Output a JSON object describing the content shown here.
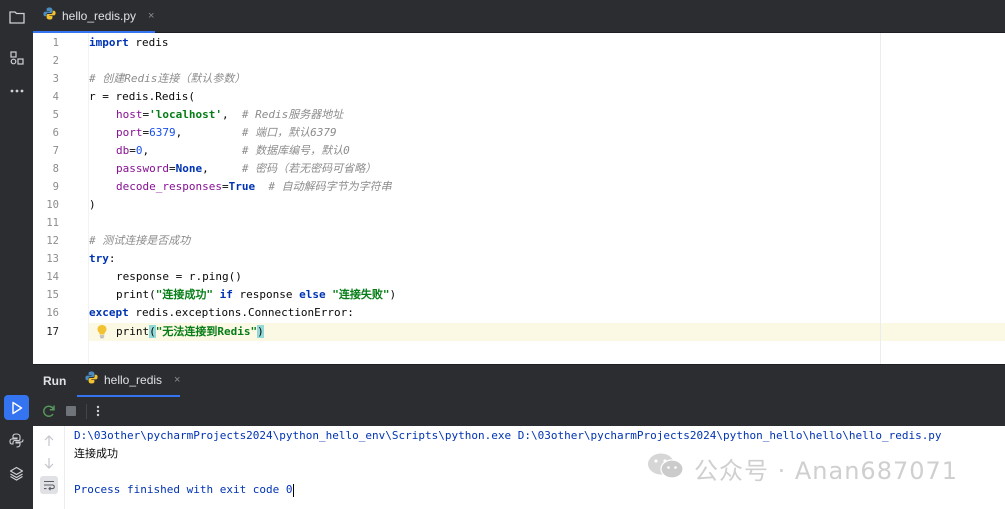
{
  "editor_tab": {
    "filename": "hello_redis.py",
    "close": "×"
  },
  "code_lines": [
    {
      "n": "1"
    },
    {
      "n": "2"
    },
    {
      "n": "3"
    },
    {
      "n": "4"
    },
    {
      "n": "5"
    },
    {
      "n": "6"
    },
    {
      "n": "7"
    },
    {
      "n": "8"
    },
    {
      "n": "9"
    },
    {
      "n": "10"
    },
    {
      "n": "11"
    },
    {
      "n": "12"
    },
    {
      "n": "13"
    },
    {
      "n": "14"
    },
    {
      "n": "15"
    },
    {
      "n": "16"
    },
    {
      "n": "17"
    }
  ],
  "code": {
    "l1_kw": "import",
    "l1_rest": " redis",
    "l3_comment": "# 创建Redis连接（默认参数）",
    "l4_a": "r = redis.Redis(",
    "l5_param": "host",
    "l5_eq": "=",
    "l5_str": "'localhost'",
    "l5_comma": ",  ",
    "l5_cmt": "# Redis服务器地址",
    "l6_param": "port",
    "l6_eq": "=",
    "l6_num": "6379",
    "l6_comma": ",         ",
    "l6_cmt": "# 端口，默认6379",
    "l7_param": "db",
    "l7_eq": "=",
    "l7_num": "0",
    "l7_comma": ",              ",
    "l7_cmt": "# 数据库编号，默认0",
    "l8_param": "password",
    "l8_eq": "=",
    "l8_kw": "None",
    "l8_comma": ",     ",
    "l8_cmt": "# 密码（若无密码可省略）",
    "l9_param": "decode_responses",
    "l9_eq": "=",
    "l9_kw": "True",
    "l9_sp": "  ",
    "l9_cmt": "# 自动解码字节为字符串",
    "l10": ")",
    "l12_comment": "# 测试连接是否成功",
    "l13_kw": "try",
    "l13_colon": ":",
    "l14": "response = r.ping()",
    "l15_fn": "print(",
    "l15_str1": "\"连接成功\"",
    "l15_if": " if",
    "l15_mid": " response ",
    "l15_else": "else",
    "l15_sp": " ",
    "l15_str2": "\"连接失败\"",
    "l15_end": ")",
    "l16_kw": "except",
    "l16_rest": " redis.exceptions.ConnectionError:",
    "l17_fn": "print",
    "l17_open": "(",
    "l17_str": "\"无法连接到Redis\"",
    "l17_close": ")"
  },
  "run_panel": {
    "title": "Run",
    "tab_label": "hello_redis",
    "tab_close": "×"
  },
  "console": {
    "command": "D:\\03other\\pycharmProjects2024\\python_hello_env\\Scripts\\python.exe D:\\03other\\pycharmProjects2024\\python_hello\\hello\\hello_redis.py",
    "output": "连接成功",
    "finished": "Process finished with exit code 0"
  },
  "watermark": {
    "text": "公众号 · Anan687071"
  },
  "colors": {
    "accent": "#3574f0",
    "keyword": "#0033b3",
    "string": "#067d17",
    "param": "#871094",
    "comment": "#8c8c8c",
    "number": "#1750eb"
  }
}
